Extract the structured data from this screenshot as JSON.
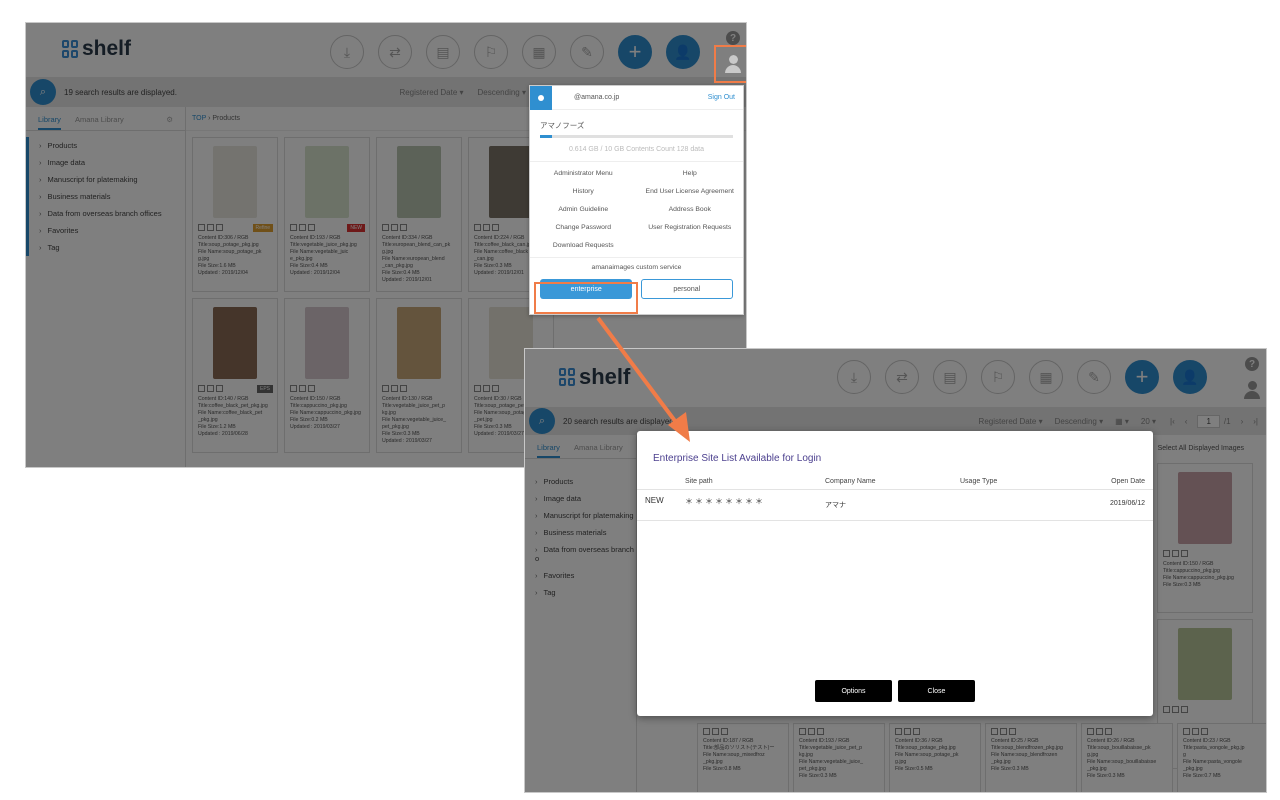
{
  "app": {
    "logo_text": "shelf"
  },
  "shot1": {
    "results_text": "19 search results are displayed.",
    "sort_field": "Registered Date ▾",
    "sort_order": "Descending ▾",
    "tabs": [
      "Library",
      "Amana Library"
    ],
    "sidebar_items": [
      "Products",
      "Image data",
      "Manuscript for platemaking",
      "Business materials",
      "Data from overseas branch offices",
      "Favorites",
      "Tag"
    ],
    "breadcrumb_top": "TOP",
    "breadcrumb_sep": "›",
    "breadcrumb_current": "Products",
    "cards": [
      {
        "color": "#e8e6df",
        "badge": "Refine",
        "badge_color": "#e0a030",
        "meta": "Content ID:306 / RGB\nTitle:soup_potage_pkg.jpg\nFile Name:soup_potage_pk\ng.jpg\nFile Size:1.6 MB\nUpdated : 2019/12/04"
      },
      {
        "color": "#d9e5cf",
        "badge": "NEW",
        "badge_color": "#d33",
        "meta": "Content ID:193 / RGB\nTitle:vegetable_juice_pkg.jpg\nFile Name:vegetable_juic\ne_pkg.jpg\nFile Size:0.4 MB\nUpdated : 2019/12/04"
      },
      {
        "color": "#b9c5b0",
        "badge": "",
        "badge_color": "",
        "meta": "Content ID:334 / RGB\nTitle:european_blend_can_pk\ng.jpg\nFile Name:european_blend\n_can_pkg.jpg\nFile Size:0.4 MB\nUpdated : 2019/12/01"
      },
      {
        "color": "#7c7468",
        "badge": "",
        "badge_color": "",
        "meta": "Content ID:224 / RGB\nTitle:coffee_black_can.jpg\nFile Name:coffee_black\n_can.jpg\nFile Size:0.3 MB\nUpdated : 2019/12/01"
      },
      {
        "color": "#8a6a55",
        "badge": "EPS",
        "badge_color": "#666",
        "meta": "Content ID:140 / RGB\nTitle:coffee_black_pet_pkg.jpg\nFile Name:coffee_black_pet\n_pkg.jpg\nFile Size:1.2 MB\nUpdated : 2019/06/28"
      },
      {
        "color": "#d6c9cf",
        "badge": "",
        "badge_color": "",
        "meta": "Content ID:150 / RGB\nTitle:cappuccino_pkg.jpg\nFile Name:cappuccino_pkg.jpg\nFile Size:0.2 MB\nUpdated : 2019/03/27"
      },
      {
        "color": "#c9a97a",
        "badge": "",
        "badge_color": "",
        "meta": "Content ID:130 / RGB\nTitle:vegetable_juice_pet_p\nkg.jpg\nFile Name:vegetable_juice_\npet_pkg.jpg\nFile Size:0.3 MB\nUpdated : 2019/03/27"
      },
      {
        "color": "#e6e2d6",
        "badge": "",
        "badge_color": "",
        "meta": "Content ID:30 / RGB\nTitle:soup_potage_pet.jpg\nFile Name:soup_potage\n_pet.jpg\nFile Size:0.3 MB\nUpdated : 2019/03/27"
      }
    ],
    "account_menu": {
      "email": "@amana.co.jp",
      "sign_out": "Sign Out",
      "company": "アマノフーズ",
      "usage_fraction": 0.06,
      "usage_text": "0.614 GB / 10 GB   Contents Count 128 data",
      "menu_items": [
        "Administrator Menu",
        "Help",
        "History",
        "End User License Agreement",
        "Admin Guideline",
        "Address Book",
        "Change Password",
        "User Registration Requests",
        "Download Requests",
        ""
      ],
      "service_label": "amanaimages custom service",
      "enterprise_label": "enterprise",
      "personal_label": "personal"
    }
  },
  "shot2": {
    "results_text": "20 search results are displayed.",
    "sort_field": "Registered Date ▾",
    "sort_order": "Descending ▾",
    "per_page": "20 ▾",
    "page_current": "1",
    "page_total": "/1",
    "select_all": "Select All Displayed Images",
    "tabs": [
      "Library",
      "Amana Library"
    ],
    "sidebar_items": [
      "Products",
      "Image data",
      "Manuscript for platemaking",
      "Business materials",
      "Data from overseas branch o",
      "Favorites",
      "Tag"
    ],
    "right_cards": [
      {
        "color": "#c9a3a8",
        "meta": "Content ID:150 / RGB\nTitle:cappuccino_pkg.jpg\nFile Name:cappuccino_pkg.jpg\nFile Size:0.3 MB"
      },
      {
        "color": "#b8c79a",
        "meta": ""
      }
    ],
    "bottom_cards": [
      "Content ID:187 / RGB\nTitle:部品のソリスト(テスト)ー\nFile Name:soup_mixedfroz\n_pkg.jpg\nFile Size:0.8 MB",
      "Content ID:193 / RGB\nTitle:vegetable_juice_pet_p\nkg.jpg\nFile Name:vegetable_juice_\npet_pkg.jpg\nFile Size:0.3 MB",
      "Content ID:36 / RGB\nTitle:soup_potage_pkg.jpg\nFile Name:soup_potage_pk\ng.jpg\nFile Size:0.5 MB",
      "Content ID:25 / RGB\nTitle:soup_blendfrozen_pkg.jpg\nFile Name:soup_blendfrozen\n_pkg.jpg\nFile Size:0.3 MB",
      "Content ID:26 / RGB\nTitle:soup_bouillabaisse_pk\ng.jpg\nFile Name:soup_bouillabaisse\n_pkg.jpg\nFile Size:0.3 MB",
      "Content ID:23 / RGB\nTitle:pasta_vongole_pkg.jp\ng\nFile Name:pasta_vongole\n_pkg.jpg\nFile Size:0.7 MB"
    ],
    "modal": {
      "title": "Enterprise Site List Available for Login",
      "headers": [
        "",
        "Site path",
        "Company Name",
        "Usage Type",
        "Open Date"
      ],
      "rows": [
        {
          "badge": "NEW",
          "site_path": "＊＊＊＊＊＊＊＊",
          "company": "アマナ",
          "usage_type": "",
          "open_date": "2019/06/12"
        }
      ],
      "options_label": "Options",
      "close_label": "Close"
    }
  },
  "colors": {
    "accent": "#2f8fd0",
    "highlight": "#f07c48",
    "modal_title": "#4b3f8e"
  }
}
